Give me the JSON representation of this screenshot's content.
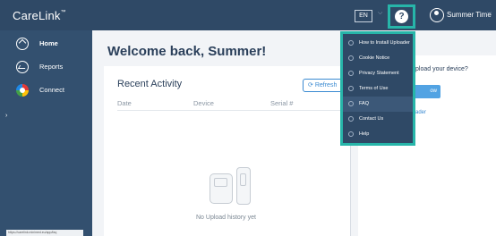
{
  "app": {
    "logo_text": "CareLink",
    "logo_mark": "™"
  },
  "topbar": {
    "language": "EN",
    "help_icon_glyph": "?",
    "user_name": "Summer Time"
  },
  "sidebar": {
    "items": [
      {
        "label": "Home",
        "icon": "home-icon",
        "active": true
      },
      {
        "label": "Reports",
        "icon": "reports-icon",
        "active": false
      },
      {
        "label": "Connect",
        "icon": "connect-icon",
        "active": false
      }
    ],
    "status_url": "https://carelink.minimed.eu/app/faq"
  },
  "main": {
    "welcome": "Welcome back, Summer!",
    "recent_activity": {
      "title": "Recent Activity",
      "refresh_label": "Refresh",
      "columns": [
        "Date",
        "Device",
        "Serial #"
      ],
      "empty_message": "No Upload history yet"
    }
  },
  "right_panel": {
    "question_text": "pload your device?",
    "button_text": "ow",
    "link_text": "ader"
  },
  "help_menu": {
    "items": [
      {
        "label": "How to Install Uploader",
        "icon": "download-icon"
      },
      {
        "label": "Cookie Notice",
        "icon": "cookie-icon"
      },
      {
        "label": "Privacy Statement",
        "icon": "document-icon"
      },
      {
        "label": "Terms of Use",
        "icon": "document-icon"
      },
      {
        "label": "FAQ",
        "icon": "question-icon",
        "selected": true
      },
      {
        "label": "Contact Us",
        "icon": "phone-icon"
      },
      {
        "label": "Help",
        "icon": "info-icon"
      }
    ]
  },
  "colors": {
    "topbar": "#2f4966",
    "sidebar": "#33506f",
    "highlight": "#27b5a9",
    "accent": "#3a8ad1"
  }
}
